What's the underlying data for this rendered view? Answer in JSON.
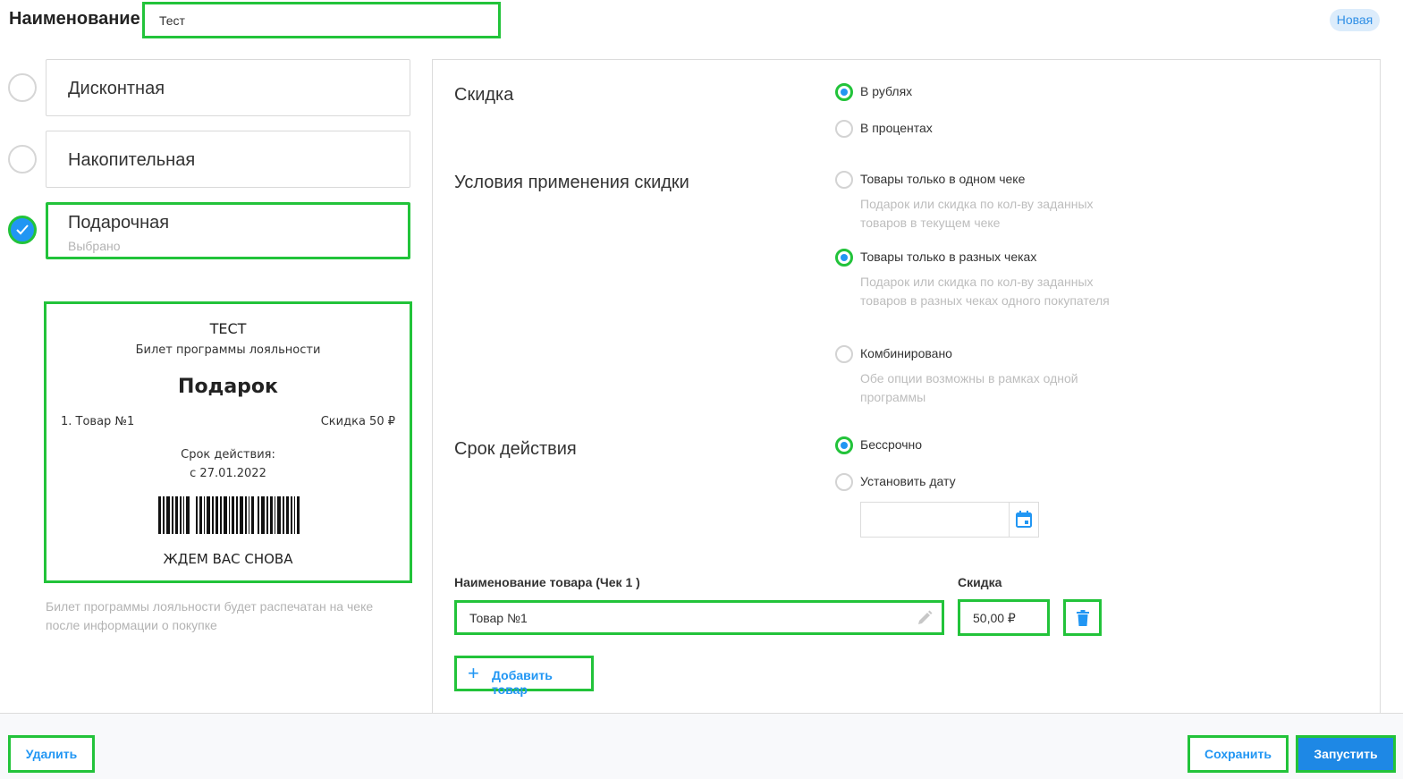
{
  "header": {
    "name_label": "Наименование",
    "name_value": "Тест",
    "status_badge": "Новая"
  },
  "types": [
    {
      "title": "Дисконтная",
      "subtitle": "",
      "selected": false
    },
    {
      "title": "Накопительная",
      "subtitle": "",
      "selected": false
    },
    {
      "title": "Подарочная",
      "subtitle": "Выбрано",
      "selected": true
    }
  ],
  "receipt": {
    "title": "ТЕСТ",
    "subtitle": "Билет программы лояльности",
    "heading": "Подарок",
    "item": "1. Товар №1",
    "item_discount": "Скидка 50 ₽",
    "validity_label": "Срок действия:",
    "validity_date": "с 27.01.2022",
    "footer": "ЖДЕМ ВАС СНОВА",
    "note": "Билет программы лояльности будет распечатан на чеке после информации о покупке"
  },
  "settings": {
    "discount": {
      "title": "Скидка",
      "options": [
        {
          "label": "В рублях",
          "selected": true
        },
        {
          "label": "В процентах",
          "selected": false
        }
      ]
    },
    "conditions": {
      "title": "Условия применения скидки",
      "options": [
        {
          "label": "Товары только в одном чеке",
          "description": "Подарок или скидка по кол-ву заданных товаров в текущем чеке",
          "selected": false
        },
        {
          "label": "Товары только в разных чеках",
          "description": "Подарок или скидка по кол-ву заданных товаров в разных чеках одного покупателя",
          "selected": true
        },
        {
          "label": "Комбинировано",
          "description": "Обе опции возможны в рамках одной программы",
          "selected": false
        }
      ]
    },
    "validity": {
      "title": "Срок действия",
      "options": [
        {
          "label": "Бессрочно",
          "selected": true
        },
        {
          "label": "Установить дату",
          "selected": false
        }
      ],
      "date_value": ""
    }
  },
  "products": {
    "name_column": "Наименование товара (Чек 1 )",
    "discount_column": "Скидка",
    "rows": [
      {
        "name": "Товар №1",
        "discount": "50,00 ₽"
      }
    ],
    "add_label": "Добавить товар"
  },
  "footer": {
    "delete_label": "Удалить",
    "save_label": "Сохранить",
    "launch_label": "Запустить"
  },
  "colors": {
    "accent": "#2196f3",
    "highlight": "#22c33a",
    "badge_bg": "#dcecfb"
  }
}
